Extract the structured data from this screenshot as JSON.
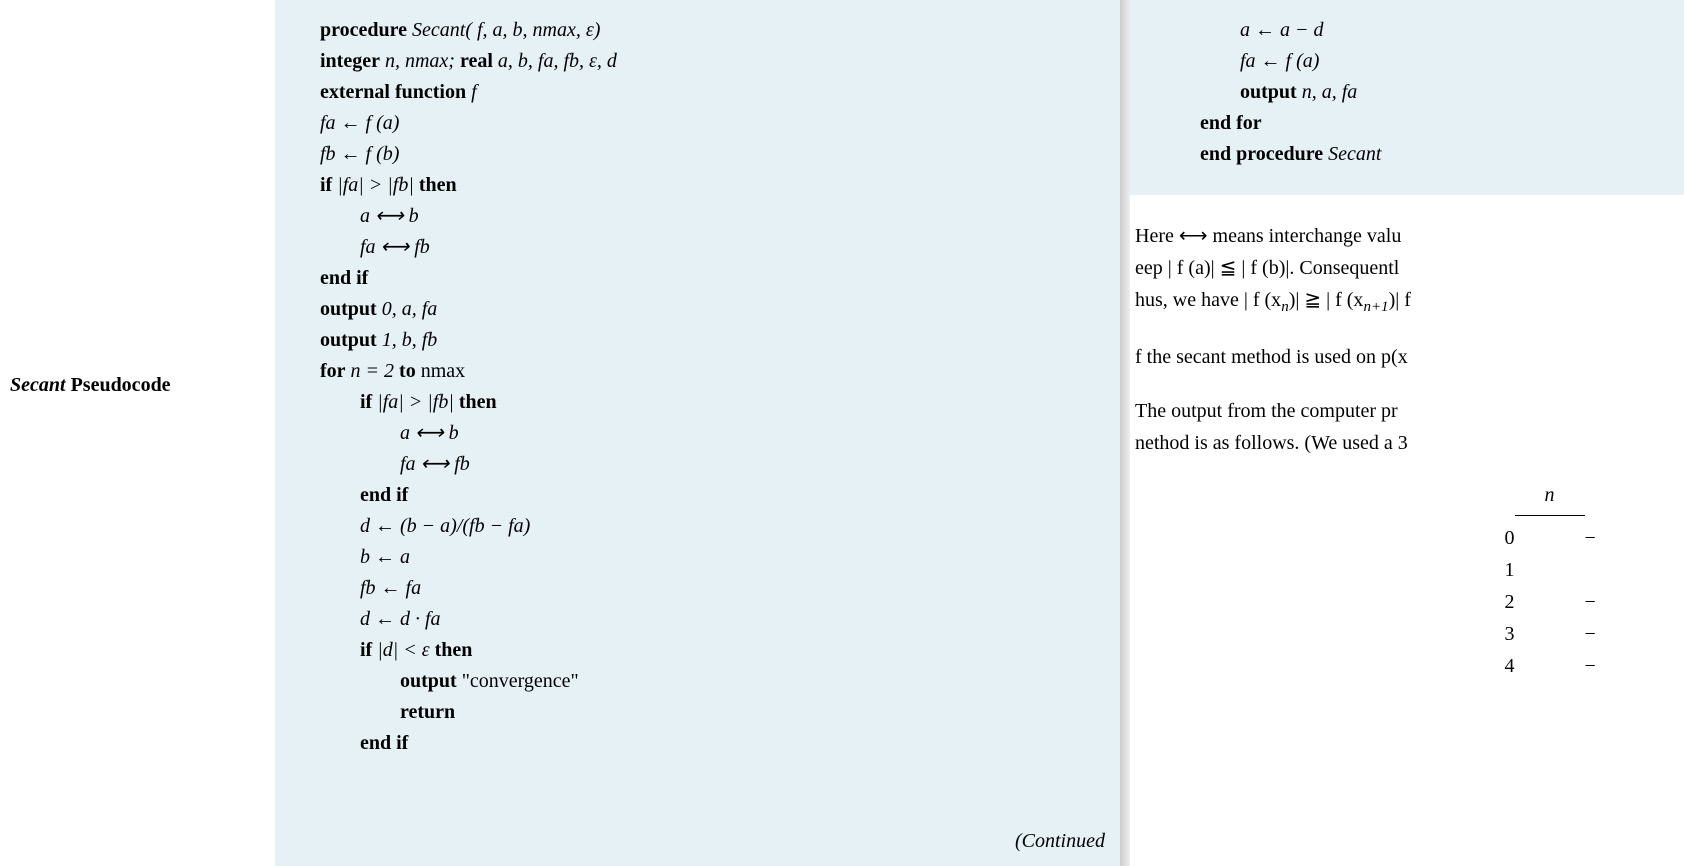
{
  "margin": {
    "label_italic": "Secant",
    "label_rest": " Pseudocode"
  },
  "pseudocode": {
    "sig": {
      "kw": "procedure",
      "name": "Secant",
      "args": "( f, a, b, nmax, ε)"
    },
    "decl1": {
      "kw1": "integer",
      "vars1": " n, nmax;    ",
      "kw2": "real",
      "vars2": " a, b, fa, fb, ε, d"
    },
    "decl2": {
      "kw": "external function",
      "name": " f"
    },
    "l1": "fa ← f (a)",
    "l2": "fb ← f (b)",
    "l3": {
      "kw1": "if",
      "mid": " |fa| > |fb| ",
      "kw2": "then"
    },
    "l4": "a ⟷ b",
    "l5": "fa ⟷ fb",
    "l6": "end if",
    "l7": {
      "kw": "output",
      "rest": " 0, a, fa"
    },
    "l8": {
      "kw": "output",
      "rest": " 1, b, fb"
    },
    "l9": {
      "kw1": "for",
      "mid": " n = 2 ",
      "kw2": "to",
      "rest": " nmax"
    },
    "l10": {
      "kw1": "if",
      "mid": " |fa| > |fb| ",
      "kw2": "then"
    },
    "l11": "a ⟷ b",
    "l12": "fa ⟷ fb",
    "l13": "end if",
    "l14": "d ← (b − a)/(fb − fa)",
    "l15": "b ← a",
    "l16": "fb ← fa",
    "l17": "d ← d · fa",
    "l18": {
      "kw1": "if",
      "mid": " |d| < ε ",
      "kw2": "then"
    },
    "l19": {
      "kw": "output",
      "rest": " \"convergence\""
    },
    "l20": "return",
    "l21": "end if",
    "continued": "(Continued"
  },
  "right_code": {
    "r1": "a ← a − d",
    "r2": "fa ← f (a)",
    "r3": {
      "kw": "output",
      "rest": " n, a, fa"
    },
    "r4": "end for",
    "r5": {
      "kw": "end procedure",
      "name": " Secant"
    }
  },
  "right_text": {
    "p1a": "Here ⟷ means interchange valu",
    "p1b": "eep | f (a)| ≦ | f (b)|. Consequentl",
    "p1c_pre": "hus, we have | f (x",
    "p1c_sub1": "n",
    "p1c_mid": ")| ≧ | f (x",
    "p1c_sub2": "n+1",
    "p1c_post": ")| f",
    "p2": "f the secant method is used on p(x",
    "p3a": "The output from the computer pr",
    "p3b": "nethod is as follows. (We used a 3"
  },
  "table": {
    "header": "n",
    "rows": [
      {
        "n": "0",
        "v": "−"
      },
      {
        "n": "1",
        "v": ""
      },
      {
        "n": "2",
        "v": "−"
      },
      {
        "n": "3",
        "v": "−"
      },
      {
        "n": "4",
        "v": "−"
      }
    ]
  }
}
